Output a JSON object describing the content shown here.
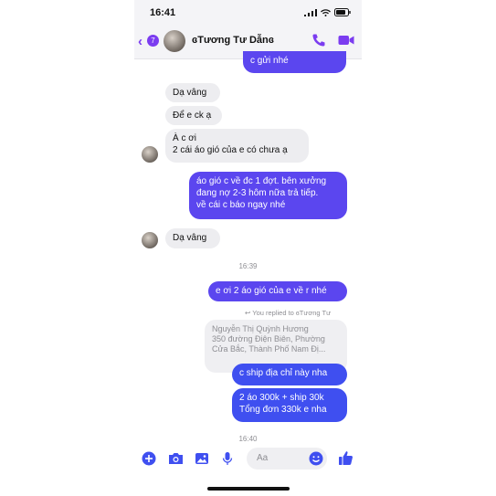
{
  "status_bar": {
    "time": "16:41"
  },
  "header": {
    "back_count": "7",
    "contact_name": "ɞTương Tư Dẫnɞ"
  },
  "messages": {
    "m1": "c gửi nhé",
    "m2": "Dạ vâng",
    "m3": "Để e ck ạ",
    "m4_line1": "À c ơi",
    "m4_line2": "2 cái áo gió của e có chưa ạ",
    "m5_line1": "áo gió c về đc 1 đợt. bên xưởng",
    "m5_line2": "đang nợ 2-3 hôm nữa trả tiếp.",
    "m5_line3": "về cái c báo ngay nhé",
    "m6": "Dạ vâng",
    "time1": "16:39",
    "m7": "e ơi 2 áo gió của e về r nhé",
    "replied_label": "You replied to ɞTương Tư",
    "quote_line1": "Nguyễn Thị Quỳnh Hương",
    "quote_line2": "350 đường Điện Biên, Phường",
    "quote_line3": "Cửa Bắc, Thành Phố Nam Đị...",
    "m8": "c ship địa chỉ này nha",
    "m9_line1": "2 áo 300k + ship 30k",
    "m9_line2": "Tổng đơn 330k e nha",
    "time2": "16:40"
  },
  "composer": {
    "placeholder": "Aa"
  },
  "colors": {
    "accent": "#7b3cf0",
    "outgoing": "#5b46ef",
    "outgoing_alt": "#3f4ff0",
    "incoming": "#ededf0"
  },
  "icons": [
    "back-chevron-icon",
    "phone-icon",
    "video-icon",
    "plus-icon",
    "camera-icon",
    "image-icon",
    "mic-icon",
    "emoji-icon",
    "like-icon"
  ]
}
